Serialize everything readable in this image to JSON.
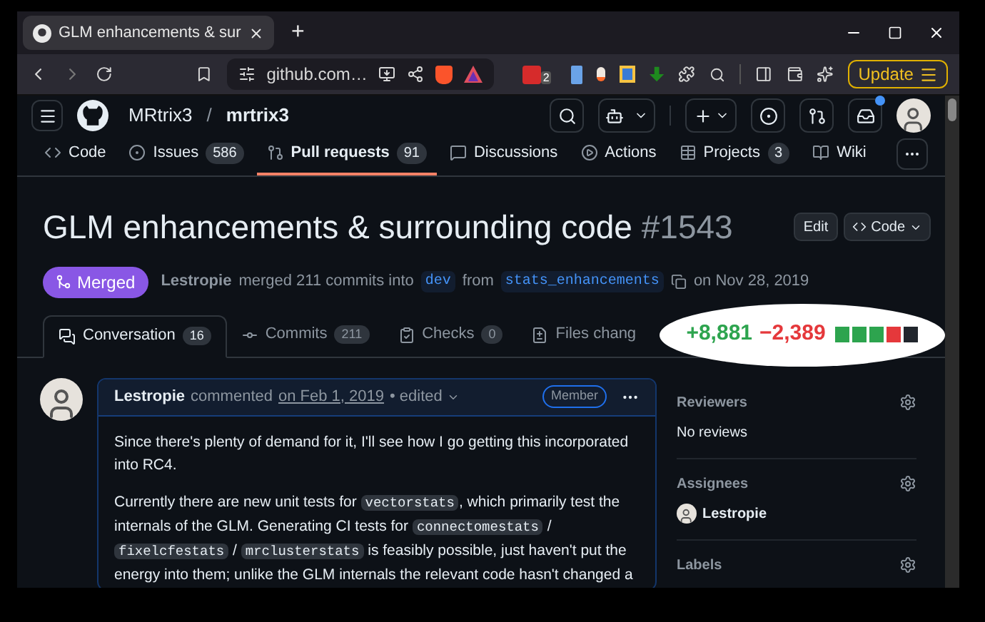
{
  "browser": {
    "tab_title": "GLM enhancements & sur",
    "new_tab": "+",
    "url": "github.com…",
    "extension_badge": "2",
    "update": "Update"
  },
  "header": {
    "owner": "MRtrix3",
    "separator": "/",
    "repo": "mrtrix3",
    "notification_dot": true
  },
  "repo_nav": [
    {
      "label": "Code",
      "selected": false
    },
    {
      "label": "Issues",
      "count": "586",
      "selected": false
    },
    {
      "label": "Pull requests",
      "count": "91",
      "selected": true
    },
    {
      "label": "Discussions",
      "selected": false
    },
    {
      "label": "Actions",
      "selected": false
    },
    {
      "label": "Projects",
      "count": "3",
      "selected": false
    },
    {
      "label": "Wiki",
      "selected": false
    }
  ],
  "pr": {
    "title": "GLM enhancements & surrounding code",
    "number": "#1543",
    "edit": "Edit",
    "code": "Code",
    "state": "Merged",
    "author": "Lestropie",
    "summary": "merged 211 commits into",
    "base": "dev",
    "from": "from",
    "head": "stats_enhancements",
    "date": "on Nov 28, 2019"
  },
  "pr_tabs": [
    {
      "label": "Conversation",
      "count": "16",
      "selected": true
    },
    {
      "label": "Commits",
      "count": "211",
      "selected": false
    },
    {
      "label": "Checks",
      "count": "0",
      "selected": false
    },
    {
      "label": "Files chang",
      "selected": false
    }
  ],
  "diffstat": {
    "additions": "+8,881",
    "deletions": "−2,389",
    "blocks": [
      {
        "color": "#2da44e"
      },
      {
        "color": "#2da44e"
      },
      {
        "color": "#2da44e"
      },
      {
        "color": "#e5383b"
      },
      {
        "color": "#21262d"
      }
    ]
  },
  "comment": {
    "author": "Lestropie",
    "action": "commented",
    "date": "on Feb 1, 2019",
    "edited": "• edited",
    "role": "Member",
    "paragraphs": [
      [
        {
          "kind": "text",
          "text": "Since there's plenty of demand for it, I'll see how I go getting this incorporated into RC4."
        }
      ],
      [
        {
          "kind": "text",
          "text": "Currently there are new unit tests for "
        },
        {
          "kind": "code",
          "text": "vectorstats"
        },
        {
          "kind": "text",
          "text": ", which primarily test the internals of the GLM. Generating CI tests for "
        },
        {
          "kind": "code",
          "text": "connectomestats"
        },
        {
          "kind": "text",
          "text": " / "
        },
        {
          "kind": "code",
          "text": "fixelcfestats"
        },
        {
          "kind": "text",
          "text": " / "
        },
        {
          "kind": "code",
          "text": "mrclusterstats"
        },
        {
          "kind": "text",
          "text": " is feasibly possible, just haven't put the energy into them; unlike the GLM internals the relevant code hasn't changed a"
        }
      ]
    ]
  },
  "sidebar": [
    {
      "title": "Reviewers",
      "value": "No reviews",
      "kind": "text"
    },
    {
      "title": "Assignees",
      "value": "Lestropie",
      "kind": "user"
    },
    {
      "title": "Labels",
      "kind": "empty"
    }
  ]
}
